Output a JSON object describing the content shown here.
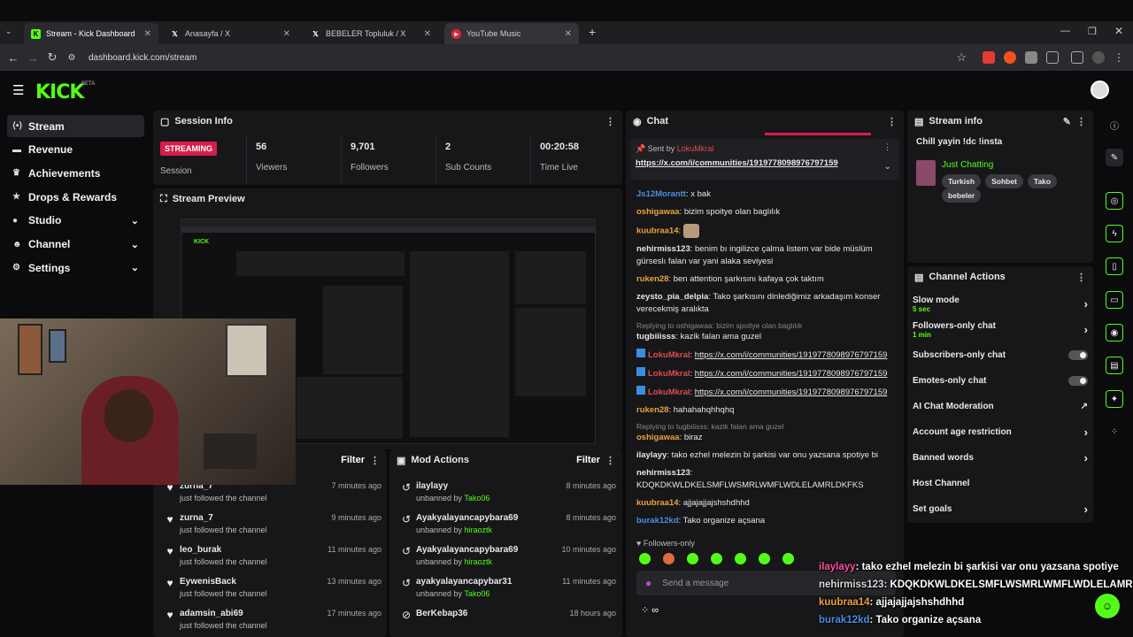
{
  "browser": {
    "tabs": [
      {
        "title": "Stream - Kick Dashboard",
        "active": true
      },
      {
        "title": "Anasayfa / X",
        "active": false
      },
      {
        "title": "BEBELER Topluluk / X",
        "active": false
      },
      {
        "title": "YouTube Music",
        "active": false
      }
    ],
    "url": "dashboard.kick.com/stream",
    "new_tab": "+"
  },
  "app": {
    "logo": "KICK",
    "beta": "BETA"
  },
  "sidebar": {
    "items": [
      {
        "label": "Stream",
        "icon": "stream-icon"
      },
      {
        "label": "Revenue",
        "icon": "money-icon"
      },
      {
        "label": "Achievements",
        "icon": "trophy-icon"
      },
      {
        "label": "Drops & Rewards",
        "icon": "gift-icon"
      },
      {
        "label": "Studio",
        "icon": "studio-icon"
      },
      {
        "label": "Channel",
        "icon": "user-icon"
      },
      {
        "label": "Settings",
        "icon": "gear-icon"
      }
    ]
  },
  "session": {
    "title": "Session Info",
    "badge": "STREAMING",
    "badge_label": "Session",
    "stats": [
      {
        "value": "56",
        "label": "Viewers"
      },
      {
        "value": "9,701",
        "label": "Followers"
      },
      {
        "value": "2",
        "label": "Sub Counts"
      },
      {
        "value": "00:20:58",
        "label": "Time Live"
      }
    ]
  },
  "preview": {
    "title": "Stream Preview"
  },
  "followers_panel": {
    "filter": "Filter",
    "rows": [
      {
        "name": "zurna_7",
        "sub": "just followed the channel",
        "time": "7 minutes ago"
      },
      {
        "name": "zurna_7",
        "sub": "just followed the channel",
        "time": "9 minutes ago"
      },
      {
        "name": "leo_burak",
        "sub": "just followed the channel",
        "time": "11 minutes ago"
      },
      {
        "name": "EywenisBack",
        "sub": "just followed the channel",
        "time": "13 minutes ago"
      },
      {
        "name": "adamsin_abi69",
        "sub": "just followed the channel",
        "time": "17 minutes ago"
      }
    ]
  },
  "mod_actions": {
    "title": "Mod Actions",
    "filter": "Filter",
    "rows": [
      {
        "name": "ilaylayy",
        "action": "unbanned by",
        "by": "Tako06",
        "time": "8 minutes ago"
      },
      {
        "name": "Ayakyalayancapybara69",
        "action": "unbanned by",
        "by": "hiraoztk",
        "time": "8 minutes ago"
      },
      {
        "name": "Ayakyalayancapybara69",
        "action": "unbanned by",
        "by": "hiraoztk",
        "time": "10 minutes ago"
      },
      {
        "name": "ayakyalayancapybar31",
        "action": "unbanned by",
        "by": "Tako06",
        "time": "11 minutes ago"
      },
      {
        "name": "BerKebap36",
        "action": "",
        "by": "",
        "time": "18 hours ago"
      }
    ]
  },
  "chat": {
    "title": "Chat",
    "pinned": {
      "sent_by": "Sent by",
      "user": "LokuMkral",
      "link": "https://x.com/i/communities/1919778098976797159"
    },
    "messages": [
      {
        "user": "Js12Morantt",
        "color": "#4a8fe0",
        "text": "x bak"
      },
      {
        "user": "oshigawaa",
        "color": "#e8a33c",
        "text": "bizim spoitye olan baglılık"
      },
      {
        "user": "kuubraa14",
        "color": "#e8a33c",
        "text": ""
      },
      {
        "user": "nehirmiss123",
        "color": "#e6e6e6",
        "text": "benim bı ingilizce çalma listem var bide müslüm gürseslı falan var yani alaka seviyesi"
      },
      {
        "user": "ruken28",
        "color": "#e8a33c",
        "text": "ben attention şarkısını kafaya çok taktım"
      },
      {
        "user": "zeysto_pia_delpia",
        "color": "#e6e6e6",
        "text": "Tako şarkısını dinlediğimiz arkadaşım konser verecekmiş aralıkta"
      },
      {
        "reply": "Replying to oshigawaa: bizim spoitye olan baglılık",
        "user": "tugbiiisss",
        "color": "#e6e6e6",
        "text": "kazik falan ama guzel"
      },
      {
        "user": "LokuMkral",
        "color": "#e04a4a",
        "link": "https://x.com/i/communities/1919778098976797159"
      },
      {
        "user": "LokuMkral",
        "color": "#e04a4a",
        "link": "https://x.com/i/communities/1919778098976797159"
      },
      {
        "user": "LokuMkral",
        "color": "#e04a4a",
        "link": "https://x.com/i/communities/1919778098976797159"
      },
      {
        "user": "ruken28",
        "color": "#e8a33c",
        "text": "hahahahqhhqhq"
      },
      {
        "reply": "Replying to tugbiiisss: kazik falan ama guzel",
        "user": "oshigawaa",
        "color": "#e8a33c",
        "text": "biraz"
      },
      {
        "user": "ilaylayy",
        "color": "#e6e6e6",
        "text": "tako ezhel melezin bi şarkisi var onu yazsana spotiye bi"
      },
      {
        "user": "nehirmiss123",
        "color": "#e6e6e6",
        "text": "KDQKDKWLDKELSMFLWSMRLWMFLWDLELAMRLDKFKS"
      },
      {
        "user": "kuubraa14",
        "color": "#e8a33c",
        "text": "ajjajajjajshshdhhd"
      },
      {
        "user": "burak12kd",
        "color": "#4a8fe0",
        "text": "Tako organize açsana"
      }
    ],
    "followers_only": "Followers-only",
    "placeholder": "Send a message"
  },
  "stream_info": {
    "title": "Stream info",
    "stream_title": "Chill yayin !dc !insta",
    "category": "Just Chatting",
    "tags": [
      "Turkish",
      "Sohbet",
      "Tako",
      "bebeler"
    ]
  },
  "channel_actions": {
    "title": "Channel Actions",
    "items": [
      {
        "label": "Slow mode",
        "sub": "5 sec",
        "control": "chevron"
      },
      {
        "label": "Followers-only chat",
        "sub": "1 min",
        "control": "chevron"
      },
      {
        "label": "Subscribers-only chat",
        "sub": "",
        "control": "toggle"
      },
      {
        "label": "Emotes-only chat",
        "sub": "",
        "control": "toggle"
      },
      {
        "label": "AI Chat Moderation",
        "sub": "",
        "control": "external"
      },
      {
        "label": "Account age restriction",
        "sub": "",
        "control": "chevron"
      },
      {
        "label": "Banned words",
        "sub": "",
        "control": "chevron"
      },
      {
        "label": "Host Channel",
        "sub": "",
        "control": "none"
      },
      {
        "label": "Set goals",
        "sub": "",
        "control": "chevron"
      }
    ]
  },
  "overlay_chat": [
    {
      "user": "ilaylayy",
      "color": "#ff4fa3",
      "text": ": tako ezhel melezin bi şarkisi var onu yazsana spotiye"
    },
    {
      "user": "nehirmiss123",
      "color": "#d8d8d8",
      "text": ": KDQKDKWLDKELSMFLWSMRLWMFLWDLELAMRLI"
    },
    {
      "user": "kuubraa14",
      "color": "#e8a33c",
      "text": ": ajjajajjajshshdhhd"
    },
    {
      "user": "burak12kd",
      "color": "#4a8fe0",
      "text": ": Tako organize açsana"
    }
  ],
  "colors": {
    "accent": "#53fc18",
    "streaming": "#d71d4a",
    "panel": "#17171a",
    "background": "#0b0b0d"
  }
}
